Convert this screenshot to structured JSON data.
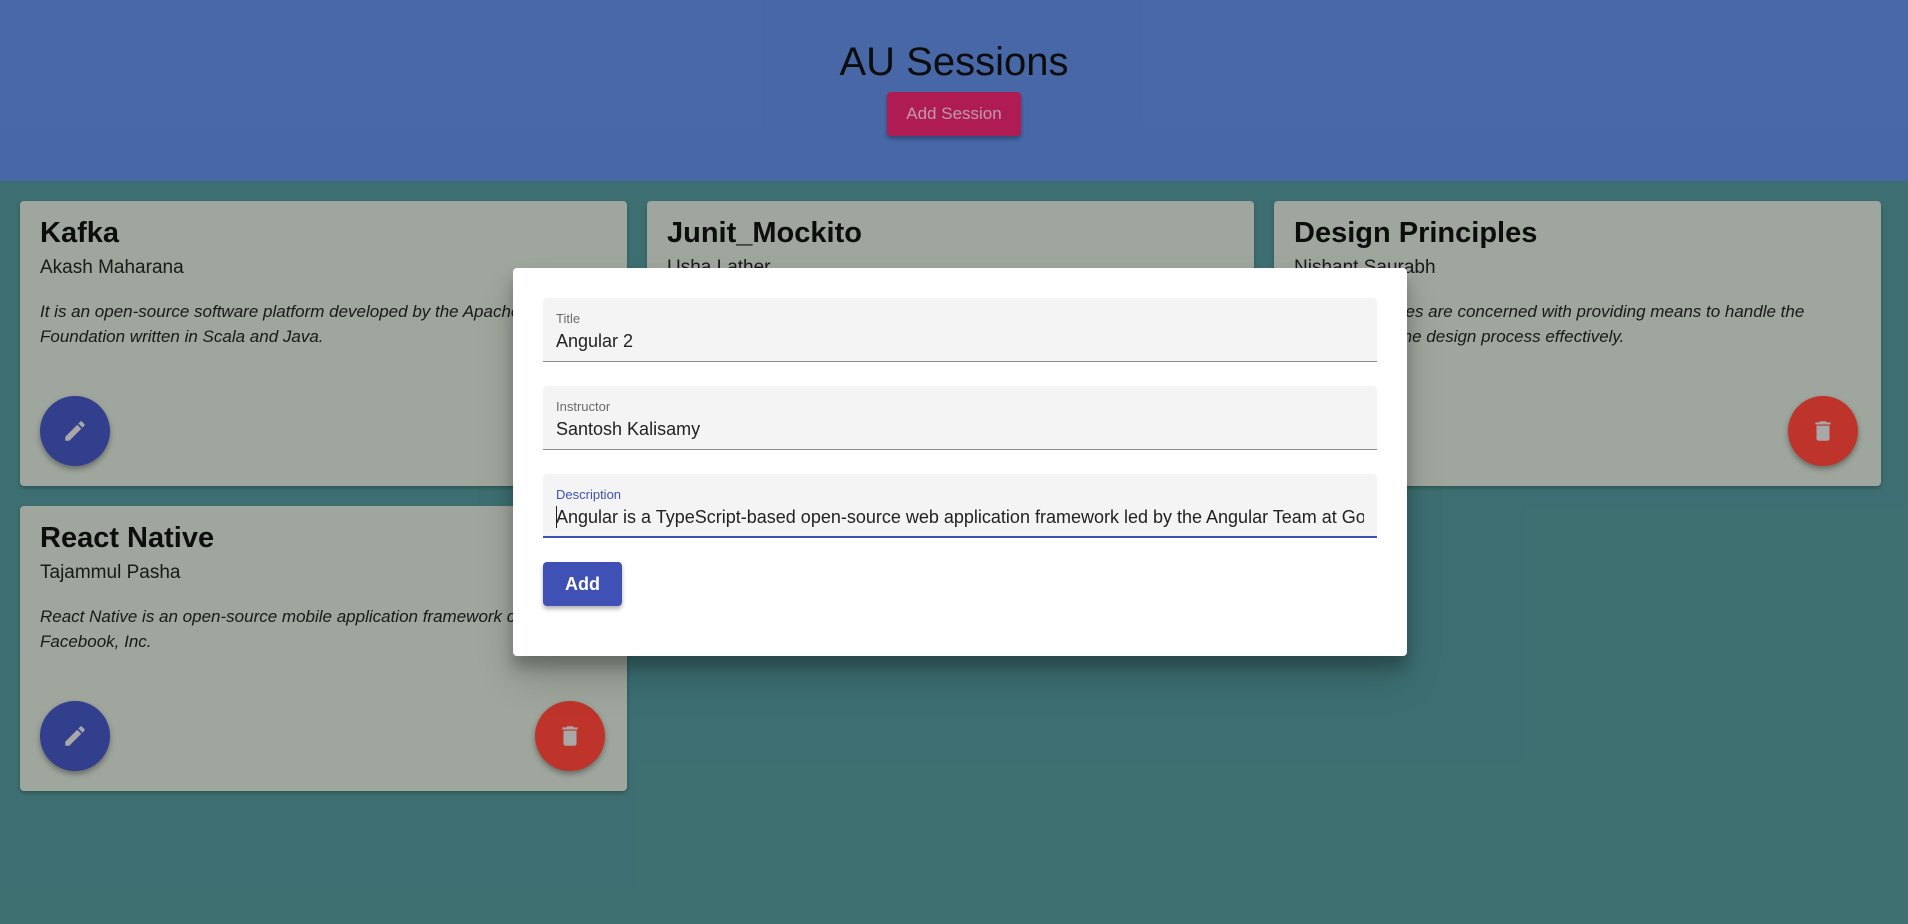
{
  "header": {
    "title": "AU Sessions",
    "add_session_label": "Add Session"
  },
  "cards": [
    {
      "title": "Kafka",
      "instructor": "Akash Maharana",
      "description": "It is an open-source software platform developed by the Apache Software Foundation written in Scala and Java."
    },
    {
      "title": "Junit_Mockito",
      "instructor": "Usha Lather",
      "description": ""
    },
    {
      "title": "Design Principles",
      "instructor": "Nishant Saurabh",
      "description": "Design principles are concerned with providing means to handle the complexity of the design process effectively."
    },
    {
      "title": "React Native",
      "instructor": "Tajammul Pasha",
      "description": "React Native is an open-source mobile application framework created by Facebook, Inc."
    }
  ],
  "icons": {
    "edit": "pencil-icon",
    "delete": "trash-icon"
  },
  "dialog": {
    "fields": {
      "title": {
        "label": "Title",
        "value": "Angular 2"
      },
      "instructor": {
        "label": "Instructor",
        "value": "Santosh Kalisamy"
      },
      "description": {
        "label": "Description",
        "value": "Angular is a TypeScript-based open-source web application framework led by the Angular Team at Googl"
      }
    },
    "add_label": "Add"
  },
  "colors": {
    "header_bg": "#5c85d6",
    "page_bg": "#4f8f92",
    "accent_pink": "#e0246c",
    "primary_indigo": "#3f51b5",
    "warn_red": "#f44336"
  }
}
